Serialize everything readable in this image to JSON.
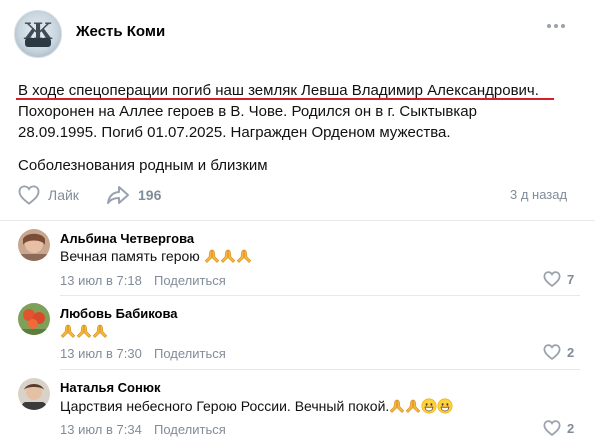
{
  "post": {
    "group_name": "Жесть Коми",
    "lines": [
      "В ходе спецоперации погиб наш земляк Левша Владимир Александрович.",
      "Похоронен на Аллее героев в В. Чове. Родился он в г. Сыктывкар",
      "28.09.1995. Погиб 01.07.2025. Награжден Орденом мужества."
    ],
    "condolence": "Соболезнования родным и близким",
    "like_label": "Лайк",
    "share_count": "196",
    "time": "3 д назад",
    "underline_color": "#d81e2b",
    "avatar_logo_letter": "Ж"
  },
  "comments": [
    {
      "author": "Альбина Четвергова",
      "text": "Вечная память герою",
      "emojis": [
        "folded-hands",
        "folded-hands",
        "folded-hands"
      ],
      "date": "13 июл в 7:18",
      "share_label": "Поделиться",
      "likes": "7"
    },
    {
      "author": "Любовь Бабикова",
      "text": "",
      "emojis": [
        "folded-hands",
        "folded-hands",
        "folded-hands"
      ],
      "date": "13 июл в 7:30",
      "share_label": "Поделиться",
      "likes": "2"
    },
    {
      "author": "Наталья Сонюк",
      "text": "Царствия небесного Герою России. Вечный покой.",
      "emojis": [
        "folded-hands",
        "folded-hands",
        "grinning-face",
        "grinning-face"
      ],
      "date": "13 июл в 7:34",
      "share_label": "Поделиться",
      "likes": "2"
    }
  ],
  "colors": {
    "muted": "#818c99",
    "divider": "#e7e8ec",
    "underline": "#d81e2b"
  },
  "icons": [
    "more-icon",
    "like-icon",
    "share-icon",
    "heart-icon",
    "folded-hands-emoji",
    "grinning-face-emoji"
  ]
}
